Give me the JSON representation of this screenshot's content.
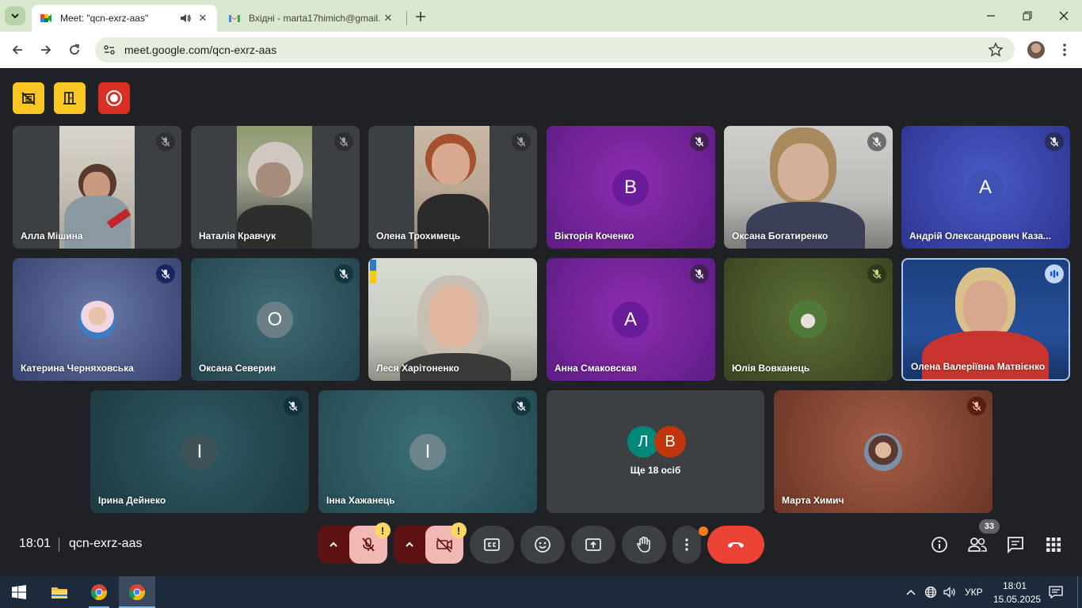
{
  "browser": {
    "tabs": [
      {
        "title": "Meet: \"qcn-exrz-aas\"",
        "icon": "google-meet-icon",
        "active": true
      },
      {
        "title": "Вхідні - marta17himich@gmail.",
        "icon": "gmail-icon",
        "active": false
      }
    ],
    "url": "meet.google.com/qcn-exrz-aas"
  },
  "meet": {
    "participants": [
      {
        "name": "Алла Мішина",
        "type": "video"
      },
      {
        "name": "Наталія Кравчук",
        "type": "video"
      },
      {
        "name": "Олена Трохимець",
        "type": "video"
      },
      {
        "name": "Вікторія Коченко",
        "type": "initial",
        "initial": "В",
        "bg": "#6a1b9a"
      },
      {
        "name": "Оксана Богатиренко",
        "type": "video"
      },
      {
        "name": "Андрій Олександрович Каза...",
        "type": "initial",
        "initial": "А",
        "bg": "#3949ab"
      },
      {
        "name": "Катерина Черняховська",
        "type": "photo"
      },
      {
        "name": "Оксана Северин",
        "type": "initial",
        "initial": "О",
        "bg": "#37474f"
      },
      {
        "name": "Леся Харітоненко",
        "type": "video"
      },
      {
        "name": "Анна Смаковская",
        "type": "initial",
        "initial": "А",
        "bg": "#6a1b9a"
      },
      {
        "name": "Юлія Вовканець",
        "type": "photo"
      },
      {
        "name": "Олена Валеріївна Матвієнко",
        "type": "video",
        "speaking": true
      },
      {
        "name": "Ірина Дейнеко",
        "type": "initial",
        "initial": "І"
      },
      {
        "name": "Інна Хажанець",
        "type": "initial",
        "initial": "І"
      },
      {
        "name": "Марта Химич",
        "type": "photo"
      }
    ],
    "more_tile": {
      "label": "Ще 18 осіб",
      "initials": [
        "Л",
        "В"
      ]
    },
    "time": "18:01",
    "meeting_code": "qcn-exrz-aas",
    "participant_count": "33",
    "warning_mark": "!"
  },
  "taskbar": {
    "language": "УКР",
    "time": "18:01",
    "date": "15.05.2025"
  }
}
